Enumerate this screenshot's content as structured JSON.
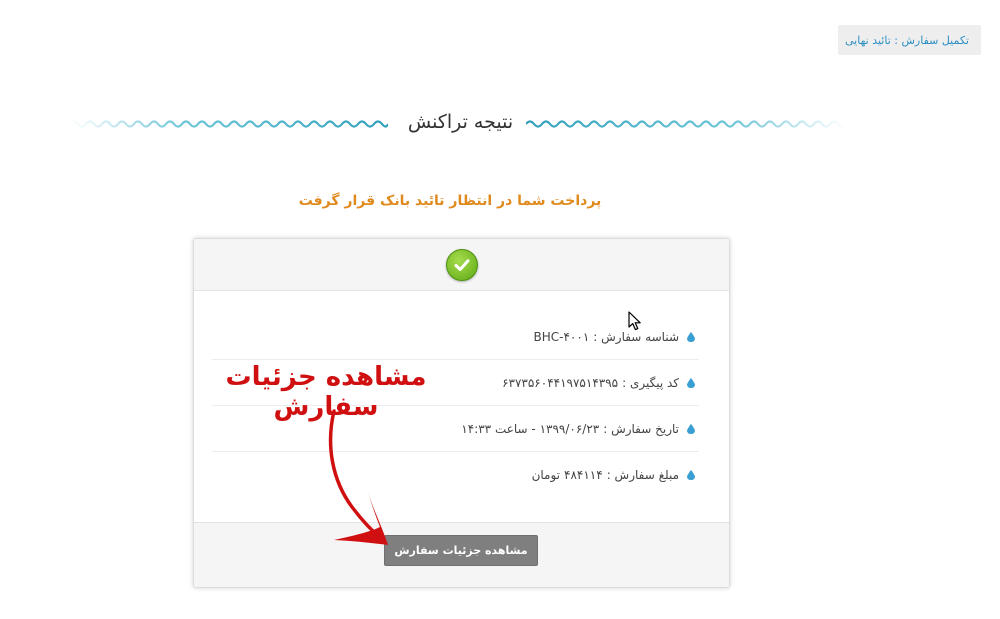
{
  "breadcrumb": {
    "text": "تکمیل سفارش : تائید نهایی"
  },
  "section": {
    "title": "نتیجه تراکنش"
  },
  "status": {
    "message": "پرداخت شما در انتظار تائید بانک قرار گرفت"
  },
  "card": {
    "header_icon": "check-circle-icon",
    "rows": [
      {
        "label": "شناسه سفارش :",
        "value": "BHC-۴۰۰۱",
        "suffix": ""
      },
      {
        "label": "کد پیگیری :",
        "value": "۶۳۷۳۵۶۰۴۴۱۹۷۵۱۴۳۹۵",
        "suffix": ""
      },
      {
        "label": "تاریخ سفارش :",
        "value": "۱۳۹۹/۰۶/۲۳ - ساعت ۱۴:۳۳",
        "suffix": ""
      },
      {
        "label": "مبلغ سفارش :",
        "value": "۴۸۴۱۱۴",
        "suffix": "تومان"
      }
    ],
    "button_label": "مشاهده جزئیات سفارش"
  },
  "annotation": {
    "text": "مشاهده جزئیات سفارش"
  },
  "colors": {
    "accent_blue": "#2e8fc4",
    "wave": "#4bb6cf",
    "status_orange": "#e08a1e",
    "button_gray": "#7f7f7f",
    "annotation_red": "#d01010",
    "success_green": "#7ac226"
  }
}
